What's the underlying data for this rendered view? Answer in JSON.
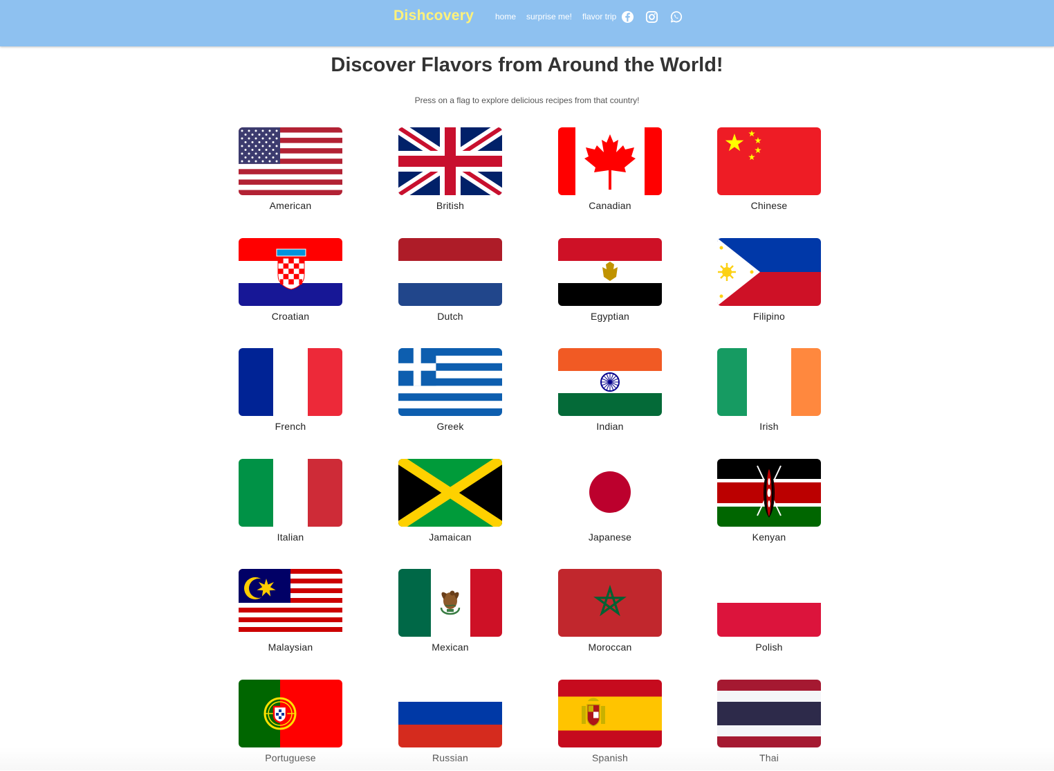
{
  "nav": {
    "brand": "Dishcovery",
    "links": [
      "home",
      "surprise me!",
      "flavor trip"
    ],
    "social_icons": [
      "facebook-icon",
      "instagram-icon",
      "whatsapp-icon"
    ],
    "background_color": "#8ec1f0",
    "brand_color": "#fff27a"
  },
  "main": {
    "heading": "Discover Flavors from Around the World!",
    "subtitle": "Press on a flag to explore delicious recipes from that country!"
  },
  "cuisines": [
    {
      "label": "American",
      "flag": "us-flag-icon"
    },
    {
      "label": "British",
      "flag": "uk-flag-icon"
    },
    {
      "label": "Canadian",
      "flag": "canada-flag-icon"
    },
    {
      "label": "Chinese",
      "flag": "china-flag-icon"
    },
    {
      "label": "Croatian",
      "flag": "croatia-flag-icon"
    },
    {
      "label": "Dutch",
      "flag": "netherlands-flag-icon"
    },
    {
      "label": "Egyptian",
      "flag": "egypt-flag-icon"
    },
    {
      "label": "Filipino",
      "flag": "philippines-flag-icon"
    },
    {
      "label": "French",
      "flag": "france-flag-icon"
    },
    {
      "label": "Greek",
      "flag": "greece-flag-icon"
    },
    {
      "label": "Indian",
      "flag": "india-flag-icon"
    },
    {
      "label": "Irish",
      "flag": "ireland-flag-icon"
    },
    {
      "label": "Italian",
      "flag": "italy-flag-icon"
    },
    {
      "label": "Jamaican",
      "flag": "jamaica-flag-icon"
    },
    {
      "label": "Japanese",
      "flag": "japan-flag-icon"
    },
    {
      "label": "Kenyan",
      "flag": "kenya-flag-icon"
    },
    {
      "label": "Malaysian",
      "flag": "malaysia-flag-icon"
    },
    {
      "label": "Mexican",
      "flag": "mexico-flag-icon"
    },
    {
      "label": "Moroccan",
      "flag": "morocco-flag-icon"
    },
    {
      "label": "Polish",
      "flag": "poland-flag-icon"
    },
    {
      "label": "Portuguese",
      "flag": "portugal-flag-icon"
    },
    {
      "label": "Russian",
      "flag": "russia-flag-icon"
    },
    {
      "label": "Spanish",
      "flag": "spain-flag-icon"
    },
    {
      "label": "Thai",
      "flag": "thailand-flag-icon"
    }
  ]
}
